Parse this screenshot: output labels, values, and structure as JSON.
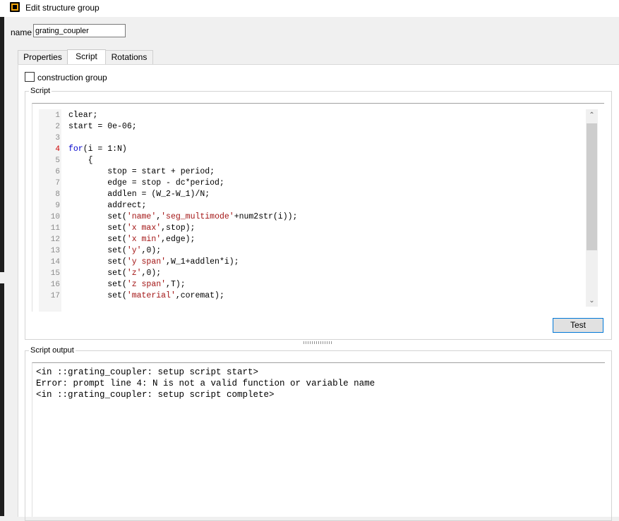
{
  "window": {
    "title": "Edit structure group"
  },
  "name_field": {
    "label": "name",
    "value": "grating_coupler"
  },
  "tabs": [
    {
      "label": "Properties"
    },
    {
      "label": "Script"
    },
    {
      "label": "Rotations"
    }
  ],
  "construction_group": {
    "label": "construction group",
    "checked": false
  },
  "script": {
    "group_label": "Script",
    "lines": [
      {
        "num": "1",
        "code": "clear;"
      },
      {
        "num": "2",
        "code": "start = 0e-06;"
      },
      {
        "num": "3",
        "code": ""
      },
      {
        "num": "4",
        "code": "for(i = 1:N)"
      },
      {
        "num": "5",
        "code": "    {"
      },
      {
        "num": "6",
        "code": "        stop = start + period;"
      },
      {
        "num": "7",
        "code": "        edge = stop - dc*period;"
      },
      {
        "num": "8",
        "code": "        addlen = (W_2-W_1)/N;"
      },
      {
        "num": "9",
        "code": "        addrect;"
      },
      {
        "num": "10",
        "code": "        set('name','seg_multimode'+num2str(i));"
      },
      {
        "num": "11",
        "code": "        set('x max',stop);"
      },
      {
        "num": "12",
        "code": "        set('x min',edge);"
      },
      {
        "num": "13",
        "code": "        set('y',0);"
      },
      {
        "num": "14",
        "code": "        set('y span',W_1+addlen*i);"
      },
      {
        "num": "15",
        "code": "        set('z',0);"
      },
      {
        "num": "16",
        "code": "        set('z span',T);"
      },
      {
        "num": "17",
        "code": "        set('material',coremat);"
      }
    ],
    "test_label": "Test"
  },
  "output": {
    "group_label": "Script output",
    "lines": [
      "<in ::grating_coupler: setup script start>",
      "Error: prompt line 4: N is not a valid function or variable name",
      "<in ::grating_coupler: setup script complete>"
    ]
  },
  "colors": {
    "keyword": "#0000cc",
    "string": "#a31515",
    "marker_line": "#cc0000",
    "button_border": "#0078d7"
  }
}
